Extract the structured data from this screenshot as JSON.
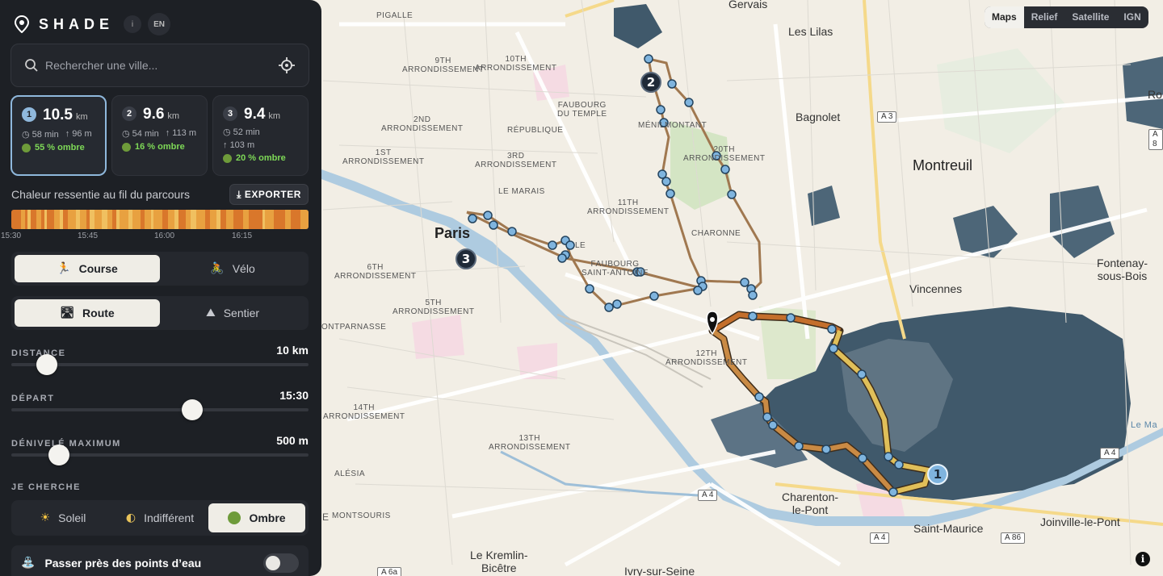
{
  "app": {
    "title": "SHADE",
    "info_badge": "i",
    "lang": "EN"
  },
  "search": {
    "placeholder": "Rechercher une ville..."
  },
  "routes": [
    {
      "num": "1",
      "distance": "10.5",
      "unit": "km",
      "duration": "58 min",
      "elevation": "96 m",
      "shade": "55 % ombre",
      "active": true
    },
    {
      "num": "2",
      "distance": "9.6",
      "unit": "km",
      "duration": "54 min",
      "elevation": "113 m",
      "shade": "16 % ombre",
      "active": false
    },
    {
      "num": "3",
      "distance": "9.4",
      "unit": "km",
      "duration": "52 min",
      "elevation": "103 m",
      "shade": "20 % ombre",
      "active": false
    }
  ],
  "heat": {
    "title": "Chaleur ressentie au fil du parcours",
    "export_label": "EXPORTER",
    "ticks": [
      "15:30",
      "15:45",
      "16:00",
      "16:15"
    ],
    "colors": {
      "hot": "#d9772b",
      "warm": "#e8a140",
      "mild": "#f0c060"
    }
  },
  "mode": {
    "options": [
      "Course",
      "Vélo"
    ],
    "selected": "Course"
  },
  "surface": {
    "options": [
      "Route",
      "Sentier"
    ],
    "selected": "Route"
  },
  "sliders": {
    "distance": {
      "label": "DISTANCE",
      "value": "10 km",
      "fraction": 0.12
    },
    "depart": {
      "label": "DÉPART",
      "value": "15:30",
      "fraction": 0.61
    },
    "denivele": {
      "label": "DÉNIVELÉ MAXIMUM",
      "value": "500 m",
      "fraction": 0.16
    }
  },
  "preference": {
    "label": "JE CHERCHE",
    "options": [
      "Soleil",
      "Indifférent",
      "Ombre"
    ],
    "selected": "Ombre"
  },
  "water": {
    "label": "Passer près des points d’eau",
    "enabled": false
  },
  "map": {
    "types": [
      "Maps",
      "Relief",
      "Satellite",
      "IGN"
    ],
    "selected_type": "Maps",
    "cities": [
      "Paris",
      "Montreuil",
      "Les Lilas",
      "Bagnolet",
      "Vincennes",
      "Fontenay-\nsous-Bois",
      "Charenton-\nle-Pont",
      "Saint-Maurice",
      "Joinville-le-Pont",
      "Le Kremlin-\nBicêtre",
      "Ivry-sur-Seine",
      "Gervais",
      "Ro"
    ],
    "districts": [
      "PIGALLE",
      "9TH\nARRONDISSEMENT",
      "10TH\nARRONDISSEMENT",
      "2ND\nARRONDISSEMENT",
      "FAUBOURG\nDU TEMPLE",
      "MÉNILMONTANT",
      "RÉPUBLIQUE",
      "1ST\nARRONDISSEMENT",
      "3RD\nARRONDISSEMENT",
      "20TH\nARRONDISSEMENT",
      "LE MARAIS",
      "11TH\nARRONDISSEMENT",
      "CHARONNE",
      "LE",
      "FAUBOURG\nSAINT-ANTOINE",
      "6TH\nARRONDISSEMENT",
      "5TH\nARRONDISSEMENT",
      "ONTPARNASSE",
      "12TH\nARRONDISSEMENT",
      "14TH\nARRONDISSEMENT",
      "13TH\nARRONDISSEMENT",
      "ALÉSIA",
      "MONTSOURIS",
      "e"
    ],
    "road_badges": [
      "A 3",
      "A 4",
      "A 4",
      "A 4",
      "A 86",
      "A 6a",
      "A 8"
    ],
    "route_markers": [
      "1",
      "2",
      "3"
    ],
    "river_label": "Le Ma",
    "info": "i"
  }
}
